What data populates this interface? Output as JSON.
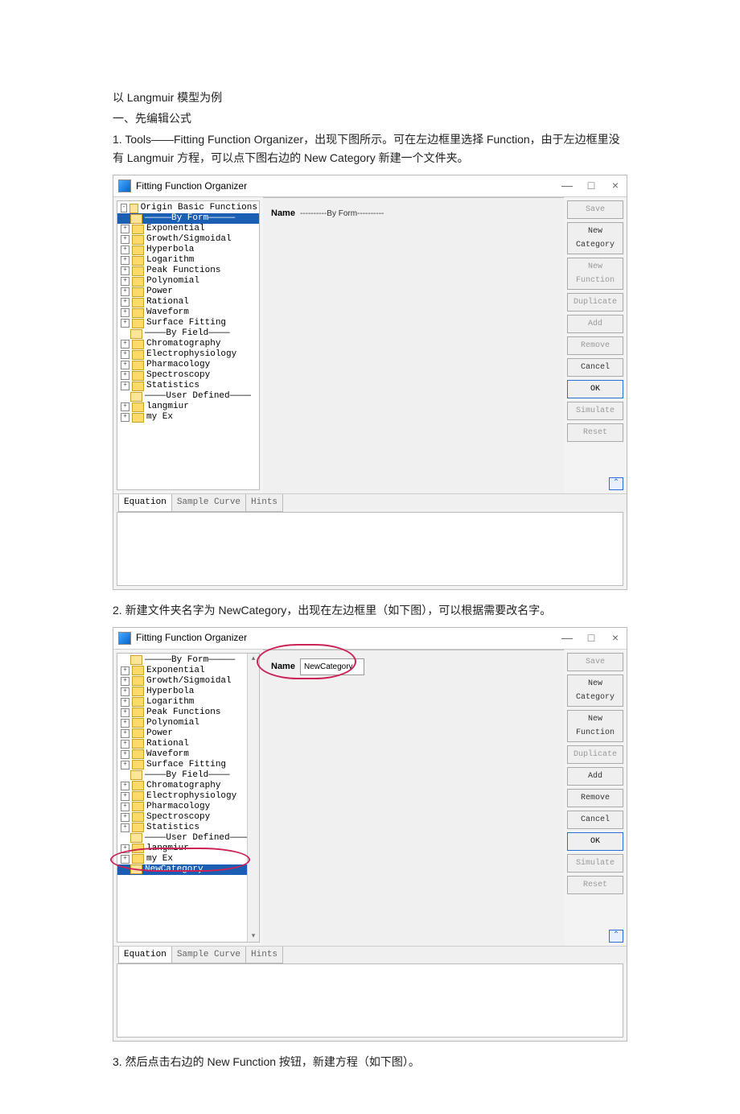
{
  "doc": {
    "l1": "以 Langmuir 模型为例",
    "l2": "一、先编辑公式",
    "l3": "1. Tools——Fitting Function Organizer，出现下图所示。可在左边框里选择 Function，由于左边框里没有 Langmuir 方程，可以点下图右边的 New Category 新建一个文件夹。",
    "l4": "2. 新建文件夹名字为 NewCategory，出现在左边框里（如下图），可以根据需要改名字。",
    "l5": "3. 然后点击右边的 New Function 按钮，新建方程（如下图）。"
  },
  "win1": {
    "title": "Fitting Function Organizer",
    "name_label": "Name",
    "name_value": "----------By Form----------",
    "tree": {
      "t0": "Origin Basic Functions",
      "t_byform": "—————By Form—————",
      "t1": "Exponential",
      "t2": "Growth/Sigmoidal",
      "t3": "Hyperbola",
      "t4": "Logarithm",
      "t5": "Peak Functions",
      "t6": "Polynomial",
      "t7": "Power",
      "t8": "Rational",
      "t9": "Waveform",
      "t10": "Surface Fitting",
      "t_byfield": "————By Field————",
      "t11": "Chromatography",
      "t12": "Electrophysiology",
      "t13": "Pharmacology",
      "t14": "Spectroscopy",
      "t15": "Statistics",
      "t_user": "————User Defined————",
      "t16": "langmiur",
      "t17": "my Ex"
    },
    "buttons": {
      "save": "Save",
      "newcat": "New Category",
      "newfun": "New Function",
      "dup": "Duplicate",
      "add": "Add",
      "remove": "Remove",
      "cancel": "Cancel",
      "ok": "OK",
      "sim": "Simulate",
      "reset": "Reset"
    },
    "tabs": {
      "eq": "Equation",
      "sc": "Sample Curve",
      "hi": "Hints"
    }
  },
  "win2": {
    "title": "Fitting Function Organizer",
    "name_label": "Name",
    "name_value": "NewCategory",
    "tree": {
      "t_byform": "—————By Form—————",
      "t1": "Exponential",
      "t2": "Growth/Sigmoidal",
      "t3": "Hyperbola",
      "t4": "Logarithm",
      "t5": "Peak Functions",
      "t6": "Polynomial",
      "t7": "Power",
      "t8": "Rational",
      "t9": "Waveform",
      "t10": "Surface Fitting",
      "t_byfield": "————By Field————",
      "t11": "Chromatography",
      "t12": "Electrophysiology",
      "t13": "Pharmacology",
      "t14": "Spectroscopy",
      "t15": "Statistics",
      "t_user": "————User Defined————",
      "t16": "langmiur",
      "t17": "my Ex",
      "t18": "NewCategory"
    }
  }
}
